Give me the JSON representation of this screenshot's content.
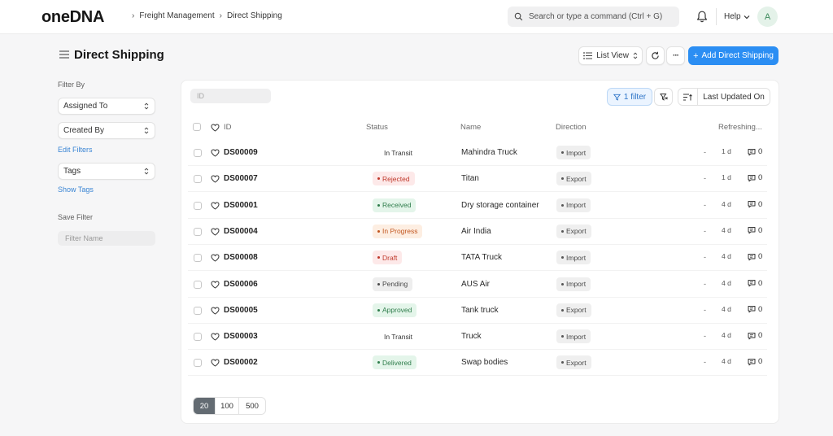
{
  "app": {
    "logo": "oneDNA"
  },
  "breadcrumb": [
    "Freight Management",
    "Direct Shipping"
  ],
  "search": {
    "placeholder": "Search or type a command (Ctrl + G)"
  },
  "header": {
    "help_label": "Help",
    "avatar_letter": "A"
  },
  "page": {
    "title": "Direct Shipping",
    "view_label": "List View",
    "more_label": "···",
    "add_label": "Add Direct Shipping"
  },
  "sidebar": {
    "filter_by_label": "Filter By",
    "assigned_to": "Assigned To",
    "created_by": "Created By",
    "edit_filters": "Edit Filters",
    "tags": "Tags",
    "show_tags": "Show Tags",
    "save_filter_label": "Save Filter",
    "filter_name_placeholder": "Filter Name"
  },
  "list": {
    "id_placeholder": "ID",
    "filter_label": "1 filter",
    "sort_label": "Last Updated On",
    "columns": {
      "id": "ID",
      "status": "Status",
      "name": "Name",
      "direction": "Direction",
      "refresh": "Refreshing..."
    },
    "rows": [
      {
        "id": "DS00009",
        "status": "In Transit",
        "name": "Mahindra Truck",
        "direction": "Import",
        "dash": "-",
        "ago": "1 d",
        "comments": "0"
      },
      {
        "id": "DS00007",
        "status": "Rejected",
        "name": "Titan",
        "direction": "Export",
        "dash": "-",
        "ago": "1 d",
        "comments": "0"
      },
      {
        "id": "DS00001",
        "status": "Received",
        "name": "Dry storage container",
        "direction": "Import",
        "dash": "-",
        "ago": "4 d",
        "comments": "0"
      },
      {
        "id": "DS00004",
        "status": "In Progress",
        "name": "Air India",
        "direction": "Export",
        "dash": "-",
        "ago": "4 d",
        "comments": "0"
      },
      {
        "id": "DS00008",
        "status": "Draft",
        "name": "TATA Truck",
        "direction": "Import",
        "dash": "-",
        "ago": "4 d",
        "comments": "0"
      },
      {
        "id": "DS00006",
        "status": "Pending",
        "name": "AUS Air",
        "direction": "Import",
        "dash": "-",
        "ago": "4 d",
        "comments": "0"
      },
      {
        "id": "DS00005",
        "status": "Approved",
        "name": "Tank truck",
        "direction": "Export",
        "dash": "-",
        "ago": "4 d",
        "comments": "0"
      },
      {
        "id": "DS00003",
        "status": "In Transit",
        "name": "Truck",
        "direction": "Import",
        "dash": "-",
        "ago": "4 d",
        "comments": "0"
      },
      {
        "id": "DS00002",
        "status": "Delivered",
        "name": "Swap bodies",
        "direction": "Export",
        "dash": "-",
        "ago": "4 d",
        "comments": "0"
      }
    ],
    "page_sizes": [
      "20",
      "100",
      "500"
    ]
  },
  "status_colors": {
    "In Transit": {
      "bg": "#ffffff",
      "fg": "#333333",
      "dot": false
    },
    "Rejected": {
      "bg": "#fde9e9",
      "fg": "#c0392b",
      "dot": true
    },
    "Received": {
      "bg": "#e4f5ea",
      "fg": "#2f7d4c",
      "dot": true
    },
    "In Progress": {
      "bg": "#fdeee2",
      "fg": "#c2561f",
      "dot": true
    },
    "Draft": {
      "bg": "#fde9e9",
      "fg": "#c0392b",
      "dot": true
    },
    "Pending": {
      "bg": "#eeeeee",
      "fg": "#4a4a4a",
      "dot": true
    },
    "Approved": {
      "bg": "#e4f5ea",
      "fg": "#2f7d4c",
      "dot": true
    },
    "Delivered": {
      "bg": "#e4f5ea",
      "fg": "#2f7d4c",
      "dot": true
    }
  },
  "colors": {
    "primary": "#2b8ef3",
    "link": "#3a85d4"
  }
}
